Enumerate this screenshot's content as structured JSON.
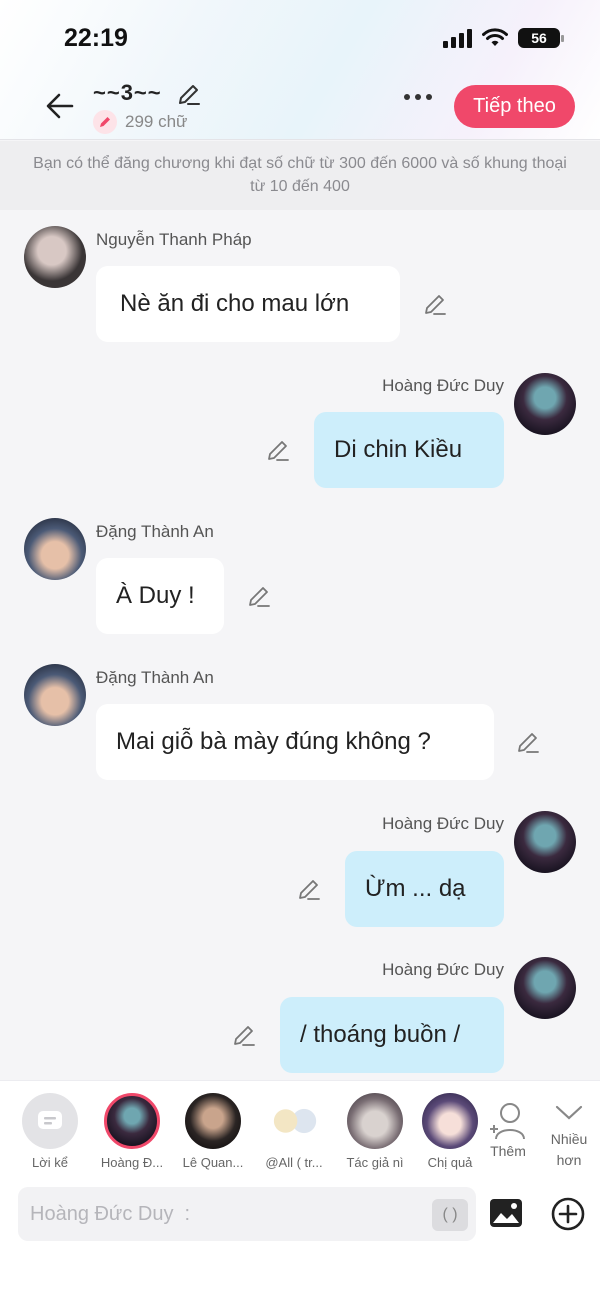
{
  "status": {
    "time": "22:19",
    "battery": "56"
  },
  "header": {
    "title": "~~3~~",
    "word_count": "299 chữ",
    "next_label": "Tiếp theo"
  },
  "notice": "Bạn có thể đăng chương khi đạt số chữ từ 300 đến 6000 và số khung thoại từ 10 đến 400",
  "messages": [
    {
      "sender": "Nguyễn Thanh Pháp",
      "text": "Nè ăn đi cho mau lớn",
      "side": "left"
    },
    {
      "sender": "Hoàng Đức Duy",
      "text": "Di chin Kiều",
      "side": "right"
    },
    {
      "sender": "Đặng Thành An",
      "text": "À Duy !",
      "side": "left"
    },
    {
      "sender": "Đặng Thành An",
      "text": "Mai giỗ bà mày đúng không ?",
      "side": "left"
    },
    {
      "sender": "Hoàng Đức Duy",
      "text": "Ừm ... dạ",
      "side": "right"
    },
    {
      "sender": "Hoàng Đức Duy",
      "text": "/ thoáng buồn /",
      "side": "right"
    }
  ],
  "characters": [
    {
      "label": "Lời kể"
    },
    {
      "label": "Hoàng Đ..."
    },
    {
      "label": "Lê Quan..."
    },
    {
      "label": "@All ( tr..."
    },
    {
      "label": "Tác giả nì"
    },
    {
      "label": "Chị quả"
    }
  ],
  "actions": {
    "add_label": "Thêm",
    "more_label": "Nhiều hơn"
  },
  "input": {
    "placeholder": "Hoàng Đức Duy  :",
    "paren": "( )"
  },
  "colors": {
    "accent": "#f0486a",
    "bubble_right": "#cdeefb",
    "bubble_left": "#ffffff"
  }
}
